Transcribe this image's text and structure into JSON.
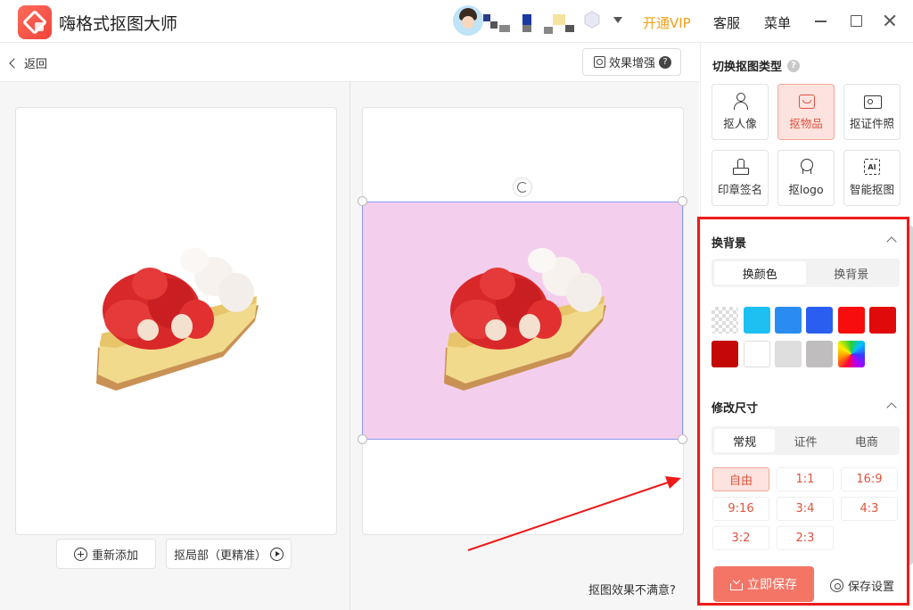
{
  "app": {
    "title": "嗨格式抠图大师"
  },
  "header": {
    "vip_label": "开通VIP",
    "service_label": "客服",
    "menu_label": "菜单"
  },
  "toolbar": {
    "back_label": "返回",
    "enhance_label": "效果增强",
    "enhance_help": "?"
  },
  "canvas": {
    "readd_label": "重新添加",
    "partial_label": "抠局部（更精准）",
    "unsatisfied_label": "抠图效果不满意?",
    "background_color": "#f4cfed"
  },
  "sidebar": {
    "type_title": "切换抠图类型",
    "type_help": "?",
    "types": [
      {
        "label": "抠人像",
        "icon": "person-icon",
        "active": false
      },
      {
        "label": "抠物品",
        "icon": "box-icon",
        "active": true
      },
      {
        "label": "抠证件照",
        "icon": "id-card-icon",
        "active": false
      },
      {
        "label": "印章签名",
        "icon": "stamp-icon",
        "active": false
      },
      {
        "label": "抠logo",
        "icon": "badge-icon",
        "active": false
      },
      {
        "label": "智能抠图",
        "icon": "ai-icon",
        "active": false
      }
    ],
    "background": {
      "title": "换背景",
      "tabs": [
        "换颜色",
        "换背景"
      ],
      "active_tab": 0,
      "swatches": [
        "transparent",
        "#1ec0f2",
        "#2a8cf0",
        "#2a5ef0",
        "#f70d0d",
        "#e00a0a",
        "#c40808",
        "#ffffff",
        "#dedede",
        "#bfbdbd",
        "rainbow"
      ]
    },
    "resize": {
      "title": "修改尺寸",
      "tabs": [
        "常规",
        "证件",
        "电商"
      ],
      "active_tab": 0,
      "options": [
        "自由",
        "1:1",
        "16:9",
        "9:16",
        "3:4",
        "4:3",
        "3:2",
        "2:3"
      ],
      "active_option": 0
    },
    "save_label": "立即保存",
    "settings_label": "保存设置"
  },
  "annotation": {
    "color": "#ee1a1a"
  }
}
